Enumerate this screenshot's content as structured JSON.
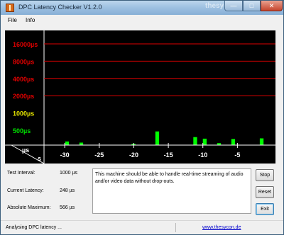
{
  "window": {
    "title": "DPC Latency Checker V1.2.0",
    "watermark": "thesycon.eu",
    "app_icon": "app-icon",
    "buttons": [
      "minimize-icon",
      "maximize-icon",
      "close-icon"
    ]
  },
  "menu": {
    "items": [
      "File",
      "Info"
    ]
  },
  "chart_data": {
    "type": "bar",
    "y_ticks": [
      {
        "label": "16000µs",
        "value": 16000,
        "color": "#e00000"
      },
      {
        "label": "8000µs",
        "value": 8000,
        "color": "#e00000"
      },
      {
        "label": "4000µs",
        "value": 4000,
        "color": "#e00000"
      },
      {
        "label": "2000µs",
        "value": 2000,
        "color": "#e00000"
      },
      {
        "label": "1000µs",
        "value": 1000,
        "color": "#e6e600"
      },
      {
        "label": "500µs",
        "value": 500,
        "color": "#00e000"
      }
    ],
    "y_scale": "log2",
    "ylabel": "µs",
    "xlabel": "s",
    "x_ticks": [
      "-30",
      "-25",
      "-20",
      "-15",
      "-10",
      "-5"
    ],
    "x_tick_values": [
      -30,
      -25,
      -20,
      -15,
      -10,
      -5
    ],
    "xlim": [
      -33,
      0
    ],
    "bar_color": "#00ff00",
    "gridline_color": "#e00000",
    "background": "#000000",
    "values": [
      257,
      201,
      229,
      212,
      318,
      188,
      205,
      304,
      223,
      257,
      200,
      222,
      185,
      271,
      205,
      241,
      221,
      175,
      291,
      246,
      166,
      247,
      182,
      476,
      218,
      194,
      239,
      162,
      271,
      233,
      210,
      380,
      178,
      357,
      220,
      200,
      298,
      217,
      195,
      352,
      196,
      208,
      186,
      201,
      176,
      361,
      218,
      188
    ]
  },
  "stats": {
    "test_interval": {
      "label": "Test Interval:",
      "value": "1000 µs"
    },
    "current_latency": {
      "label": "Current Latency:",
      "value": "248 µs"
    },
    "absolute_maximum": {
      "label": "Absolute Maximum:",
      "value": "566 µs"
    }
  },
  "message": "This machine should be able to handle real-time streaming of audio and/or video data without drop-outs.",
  "buttons": {
    "stop": "Stop",
    "reset": "Reset",
    "exit": "Exit"
  },
  "status": {
    "text": "Analysing DPC latency ...",
    "link": "www.thesycon.de"
  }
}
